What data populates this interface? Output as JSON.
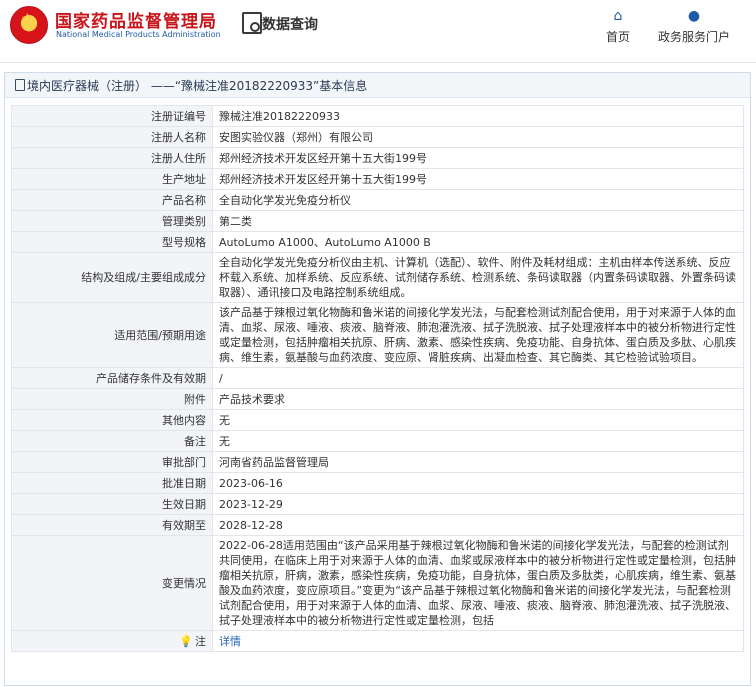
{
  "header": {
    "site_title_cn": "国家药品监督管理局",
    "site_title_en": "National Medical Products Administration",
    "db_title": "数据查询",
    "nav": [
      {
        "label": "首页",
        "icon": "home-icon"
      },
      {
        "label": "政务服务门户",
        "icon": "user-icon"
      }
    ]
  },
  "card": {
    "title": "境内医疗器械（注册） ——“豫械注准20182220933”基本信息"
  },
  "fields": {
    "reg_no": {
      "label": "注册证编号",
      "value": "豫械注准20182220933"
    },
    "registrant": {
      "label": "注册人名称",
      "value": "安图实验仪器（郑州）有限公司"
    },
    "registrant_addr": {
      "label": "注册人住所",
      "value": "郑州经济技术开发区经开第十五大街199号"
    },
    "prod_addr": {
      "label": "生产地址",
      "value": "郑州经济技术开发区经开第十五大街199号"
    },
    "product_name": {
      "label": "产品名称",
      "value": "全自动化学发光免疫分析仪"
    },
    "category": {
      "label": "管理类别",
      "value": "第二类"
    },
    "model": {
      "label": "型号规格",
      "value": "AutoLumo A1000、AutoLumo A1000 B"
    },
    "structure": {
      "label": "结构及组成/主要组成成分",
      "value": "全自动化学发光免疫分析仪由主机、计算机（选配）、软件、附件及耗材组成：主机由样本传送系统、反应杯载入系统、加样系统、反应系统、试剂储存系统、检测系统、条码读取器（内置条码读取器、外置条码读取器）、通讯接口及电路控制系统组成。"
    },
    "scope": {
      "label": "适用范围/预期用途",
      "value": "该产品基于辣根过氧化物酶和鲁米诺的间接化学发光法，与配套检测试剂配合使用，用于对来源于人体的血清、血浆、尿液、唾液、痰液、脑脊液、肺泡灌洗液、拭子洗脱液、拭子处理液样本中的被分析物进行定性或定量检测，包括肿瘤相关抗原、肝病、激素、感染性疾病、免疫功能、自身抗体、蛋白质及多肽、心肌疾病、维生素，氨基酸与血药浓度、变应原、肾脏疾病、出凝血检查、其它酶类、其它检验试验项目。"
    },
    "storage": {
      "label": "产品储存条件及有效期",
      "value": "/"
    },
    "attachment": {
      "label": "附件",
      "value": "产品技术要求"
    },
    "other": {
      "label": "其他内容",
      "value": "无"
    },
    "remark": {
      "label": "备注",
      "value": "无"
    },
    "approval_dept": {
      "label": "审批部门",
      "value": "河南省药品监督管理局"
    },
    "approval_date": {
      "label": "批准日期",
      "value": "2023-06-16"
    },
    "effective_date": {
      "label": "生效日期",
      "value": "2023-12-29"
    },
    "expiry_date": {
      "label": "有效期至",
      "value": "2028-12-28"
    },
    "changes": {
      "label": "变更情况",
      "value": "2022-06-28适用范围由“该产品采用基于辣根过氧化物酶和鲁米诺的间接化学发光法，与配套的检测试剂共同使用，在临床上用于对来源于人体的血清、血浆或尿液样本中的被分析物进行定性或定量检测，包括肿瘤相关抗原，肝病，激素，感染性疾病，免疫功能，自身抗体，蛋白质及多肽类，心肌疾病，维生素、氨基酸及血药浓度，变应原项目。”变更为“该产品基于辣根过氧化物酶和鲁米诺的间接化学发光法，与配套检测试剂配合使用，用于对来源于人体的血清、血浆、尿液、唾液、痰液、脑脊液、肺泡灌洗液、拭子洗脱液、拭子处理液样本中的被分析物进行定性或定量检测，包括"
    },
    "note": {
      "label": "注",
      "value": "详情",
      "icon": "lightbulb-icon"
    }
  }
}
